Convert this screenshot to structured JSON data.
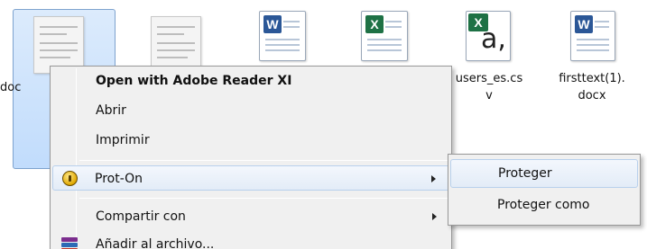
{
  "files": [
    {
      "id": "doc",
      "label": "doc",
      "icon": "pdf-thumbnail-icon",
      "selected": true
    },
    {
      "id": "doc2",
      "label": "",
      "icon": "pdf-thumbnail-icon"
    },
    {
      "id": "word1",
      "label": "",
      "icon": "word-document-icon"
    },
    {
      "id": "excel1",
      "label": "",
      "icon": "excel-spreadsheet-icon"
    },
    {
      "id": "users_csv",
      "label_line1": "users_es.cs",
      "label_line2": "v",
      "icon": "csv-file-icon",
      "badge": "a,"
    },
    {
      "id": "firsttext",
      "label_line1": "firsttext(1).",
      "label_line2": "docx",
      "icon": "word-document-icon"
    }
  ],
  "context_menu": {
    "items": [
      {
        "label": "Open with Adobe Reader XI",
        "bold": true
      },
      {
        "label": "Abrir"
      },
      {
        "label": "Imprimir"
      },
      {
        "label": "Prot-On",
        "icon": "prot-on-key-icon",
        "has_submenu": true,
        "highlighted": true
      },
      {
        "label": "Compartir con",
        "has_submenu": true
      },
      {
        "label": "Añadir al archivo...",
        "icon": "winrar-icon"
      }
    ]
  },
  "submenu": {
    "items": [
      {
        "label": "Proteger",
        "highlighted": true
      },
      {
        "label": "Proteger como"
      }
    ]
  },
  "colors": {
    "selection": "#c9e0fc",
    "menu_bg": "#f0f0f0",
    "hover_border": "#b8d0ec",
    "word_blue": "#2b5797",
    "excel_green": "#1e7145"
  }
}
